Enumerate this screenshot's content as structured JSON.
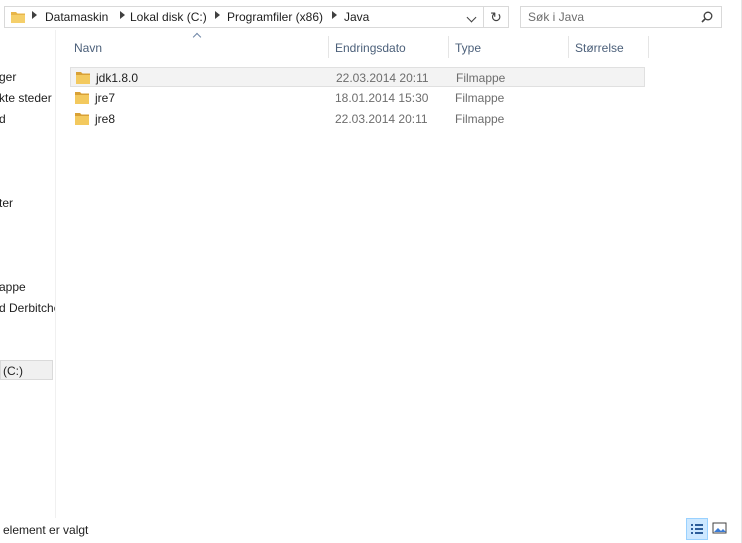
{
  "address_bar": {
    "crumbs": [
      "Datamaskin",
      "Lokal disk (C:)",
      "Programfiler (x86)",
      "Java"
    ],
    "folder_icon": "folder-icon",
    "dropdown_icon": "chevron-down-icon",
    "refresh_icon": "refresh-icon"
  },
  "search": {
    "placeholder": "Søk i Java",
    "icon": "search-icon"
  },
  "nav_pane": {
    "items": [
      "ger",
      "kte steder",
      "d",
      "ter",
      "appe",
      "d Derbitche",
      "(C:)"
    ],
    "selected_item": "(C:)"
  },
  "columns": {
    "name": "Navn",
    "date": "Endringsdato",
    "type": "Type",
    "size": "Størrelse"
  },
  "files": [
    {
      "name": "jdk1.8.0",
      "date": "22.03.2014 20:11",
      "type": "Filmappe",
      "size": "",
      "selected": true
    },
    {
      "name": "jre7",
      "date": "18.01.2014 15:30",
      "type": "Filmappe",
      "size": "",
      "selected": false
    },
    {
      "name": "jre8",
      "date": "22.03.2014 20:11",
      "type": "Filmappe",
      "size": "",
      "selected": false
    }
  ],
  "status_bar": {
    "text": "element er valgt",
    "view_buttons": [
      "details-view-icon",
      "large-icons-view-icon"
    ],
    "active_view": "details-view-icon"
  },
  "colors": {
    "folder": "#e8b64a",
    "header_text": "#4c607a",
    "selection_bg": "#f3f3f3",
    "active_view_bg": "#cde8ff"
  }
}
